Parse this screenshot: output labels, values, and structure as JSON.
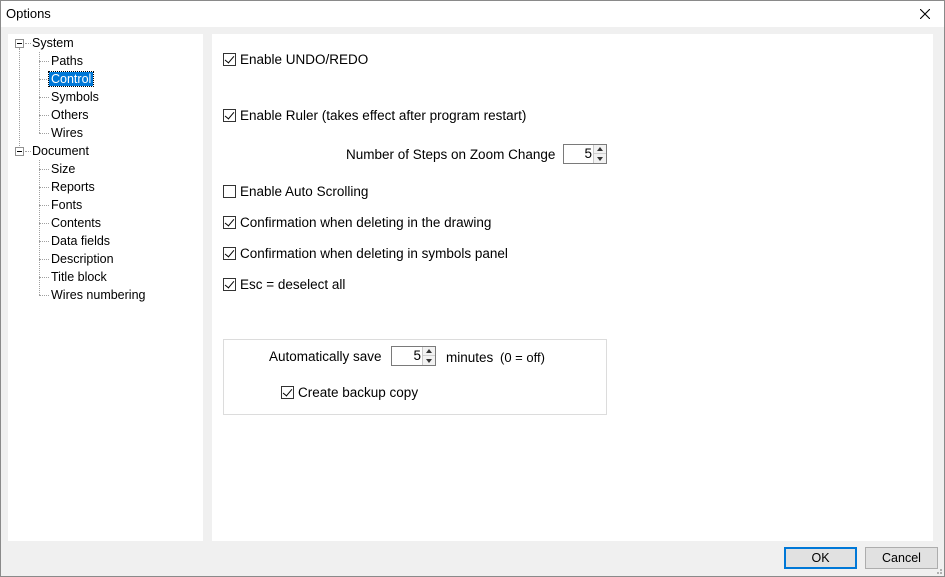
{
  "window": {
    "title": "Options"
  },
  "tree": {
    "system": {
      "label": "System",
      "children": [
        "Paths",
        "Control",
        "Symbols",
        "Others",
        "Wires"
      ]
    },
    "document": {
      "label": "Document",
      "children": [
        "Size",
        "Reports",
        "Fonts",
        "Contents",
        "Data fields",
        "Description",
        "Title block",
        "Wires numbering"
      ]
    },
    "selected": "Control"
  },
  "control": {
    "enable_undo": {
      "label": "Enable UNDO/REDO",
      "checked": true
    },
    "enable_ruler": {
      "label": "Enable Ruler (takes effect after program restart)",
      "checked": true
    },
    "zoom_steps": {
      "label": "Number of Steps on Zoom Change",
      "value": "5"
    },
    "auto_scroll": {
      "label": "Enable Auto Scrolling",
      "checked": false
    },
    "confirm_drawing": {
      "label": "Confirmation when deleting in the drawing",
      "checked": true
    },
    "confirm_symbols": {
      "label": "Confirmation when deleting in symbols panel",
      "checked": true
    },
    "esc_deselect": {
      "label": "Esc = deselect all",
      "checked": true
    },
    "autosave": {
      "label": "Automatically save",
      "value": "5",
      "unit": "minutes",
      "hint": "(0 = off)"
    },
    "backup": {
      "label": "Create backup copy",
      "checked": true
    }
  },
  "buttons": {
    "ok": "OK",
    "cancel": "Cancel"
  }
}
